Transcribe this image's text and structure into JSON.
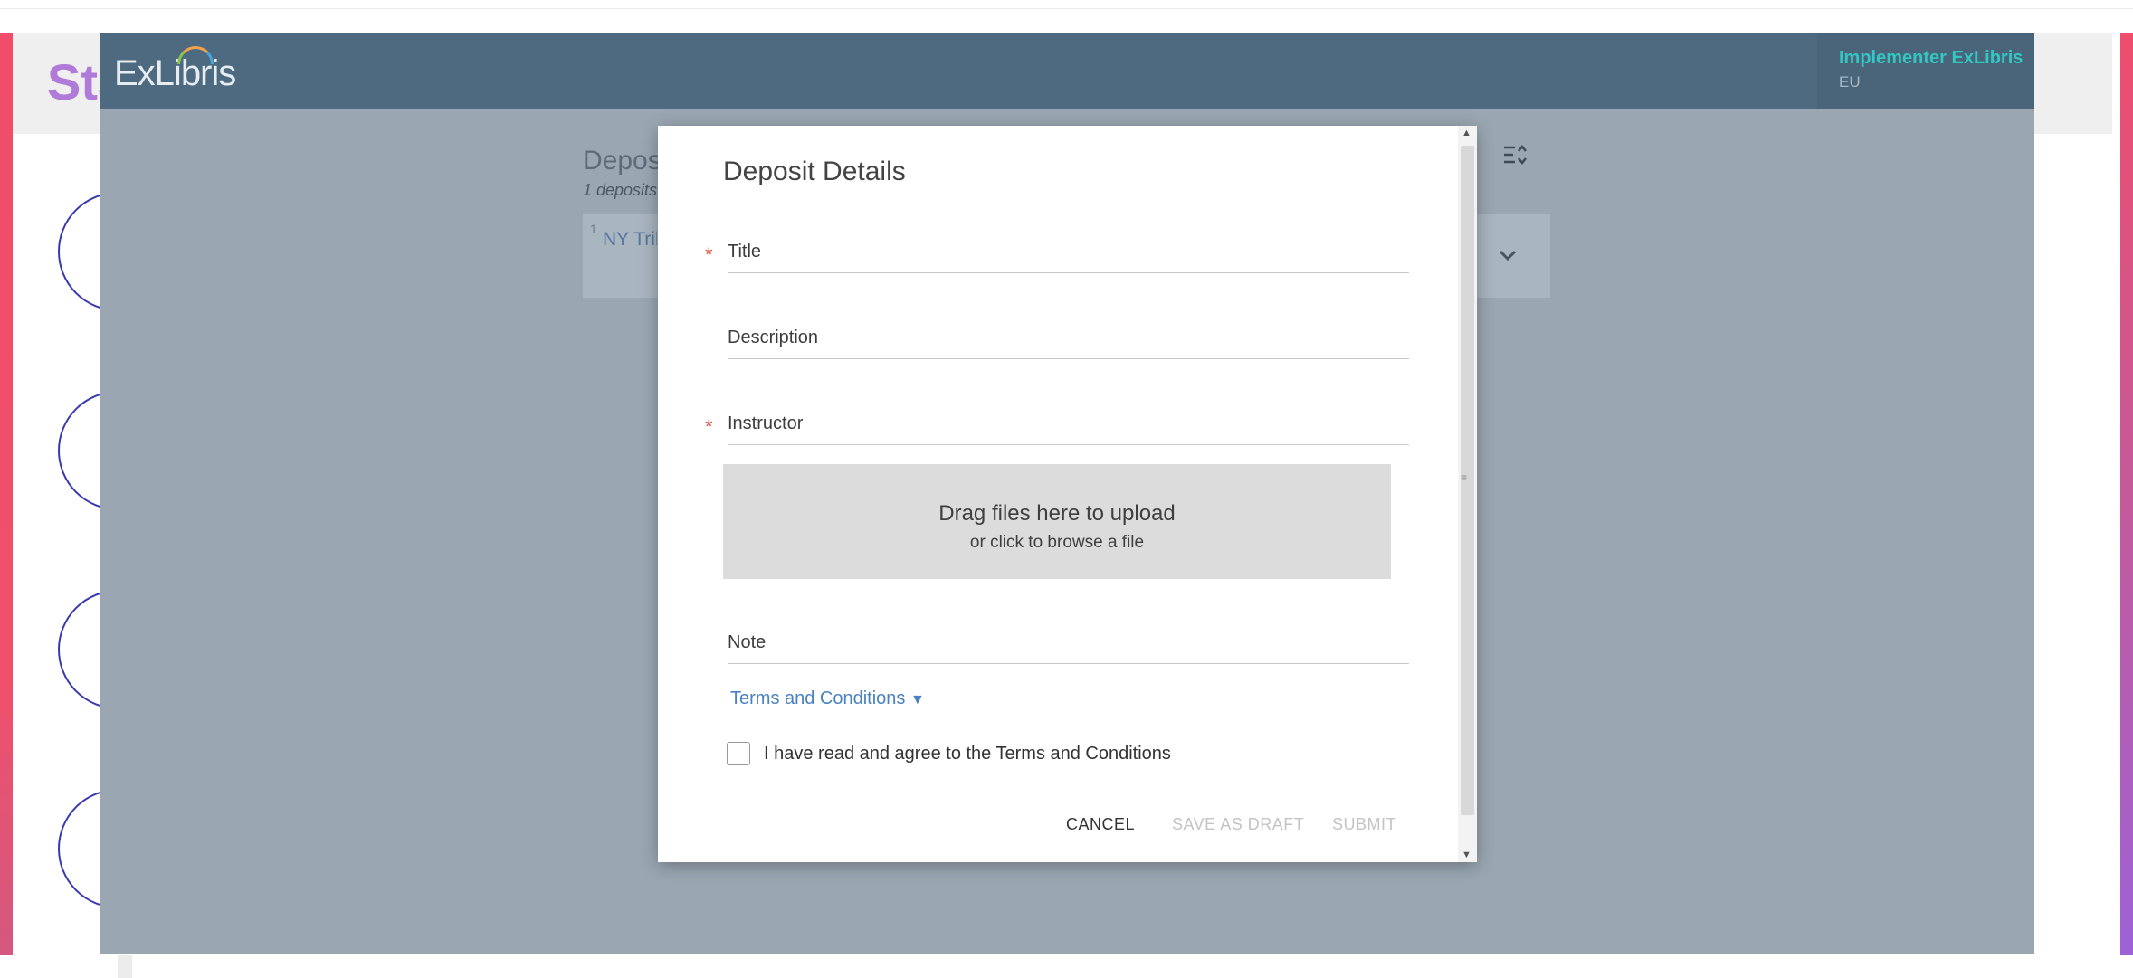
{
  "background": {
    "title": "Sta"
  },
  "header": {
    "logo": "ExLibris",
    "user_name": "Implementer ExLibris",
    "user_region": "EU"
  },
  "deposits": {
    "title": "Depos",
    "count": "1 deposits",
    "rows": [
      {
        "number": "1",
        "title": "NY Trib"
      }
    ]
  },
  "modal": {
    "title": "Deposit Details",
    "fields": {
      "title_label": "Title",
      "description_label": "Description",
      "instructor_label": "Instructor",
      "note_label": "Note"
    },
    "dropzone": {
      "main": "Drag files here to upload",
      "sub": "or click to browse a file"
    },
    "terms_link": "Terms and Conditions",
    "terms_arrow": "▼",
    "agree_label": "I have read and agree to the Terms and Conditions",
    "agree_checked": false,
    "buttons": {
      "cancel": "CANCEL",
      "save_draft": "SAVE AS DRAFT",
      "submit": "SUBMIT"
    }
  },
  "colors": {
    "header_bg": "#4d6a80",
    "overlay_bg": "#9aa7b2",
    "user_name": "#33c6c2",
    "link": "#4a82c0",
    "required": "#e0564b",
    "disabled": "#c4c4c4"
  }
}
